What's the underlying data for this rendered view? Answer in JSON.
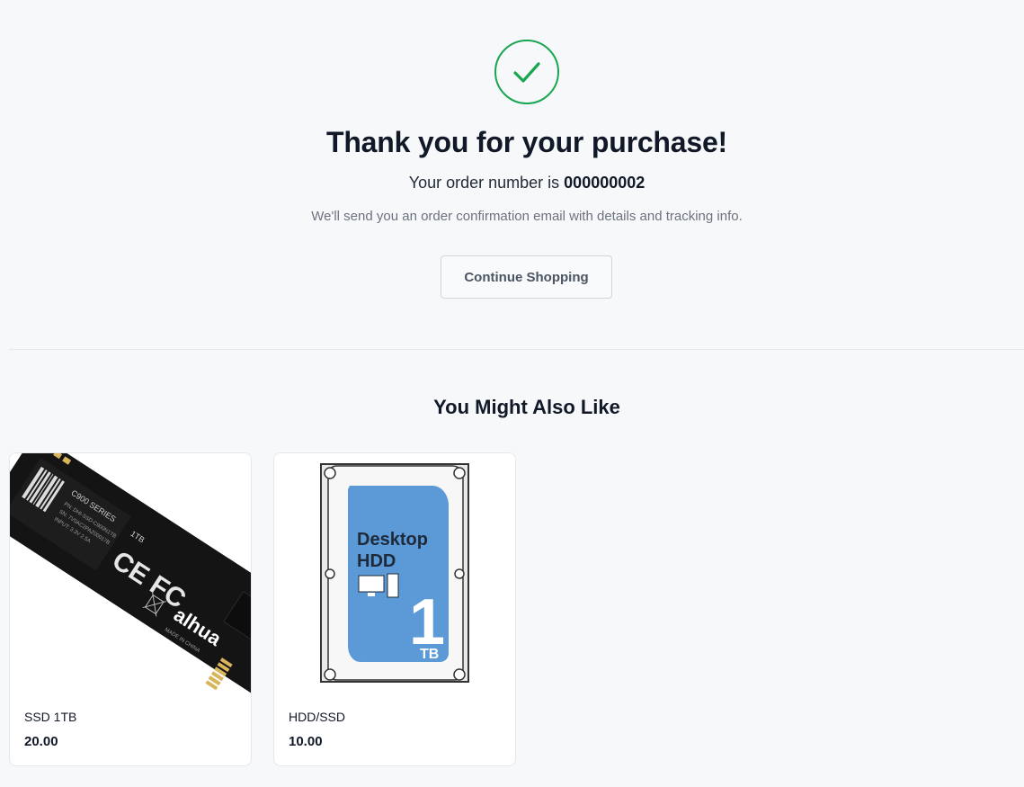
{
  "confirmation": {
    "title": "Thank you for your purchase!",
    "order_prefix": "Your order number is",
    "order_number": "000000002",
    "note": "We'll send you an order confirmation email with details and tracking info.",
    "continue_label": "Continue Shopping",
    "accent_color": "#1aa551",
    "icon": "check-circle-icon"
  },
  "recommendations": {
    "title": "You Might Also Like",
    "products": [
      {
        "name": "SSD 1TB",
        "price": "20.00",
        "image_icon": "ssd-image",
        "image_text": {
          "series": "C900 SERIES",
          "capacity": "1TB",
          "ce": "CE FC",
          "brand": "alhua",
          "origin": "MADE IN CHINA"
        }
      },
      {
        "name": "HDD/SSD",
        "price": "10.00",
        "image_icon": "hdd-image",
        "image_text": {
          "line1": "Desktop",
          "line2": "HDD",
          "capacity": "1",
          "unit": "TB"
        }
      }
    ]
  }
}
